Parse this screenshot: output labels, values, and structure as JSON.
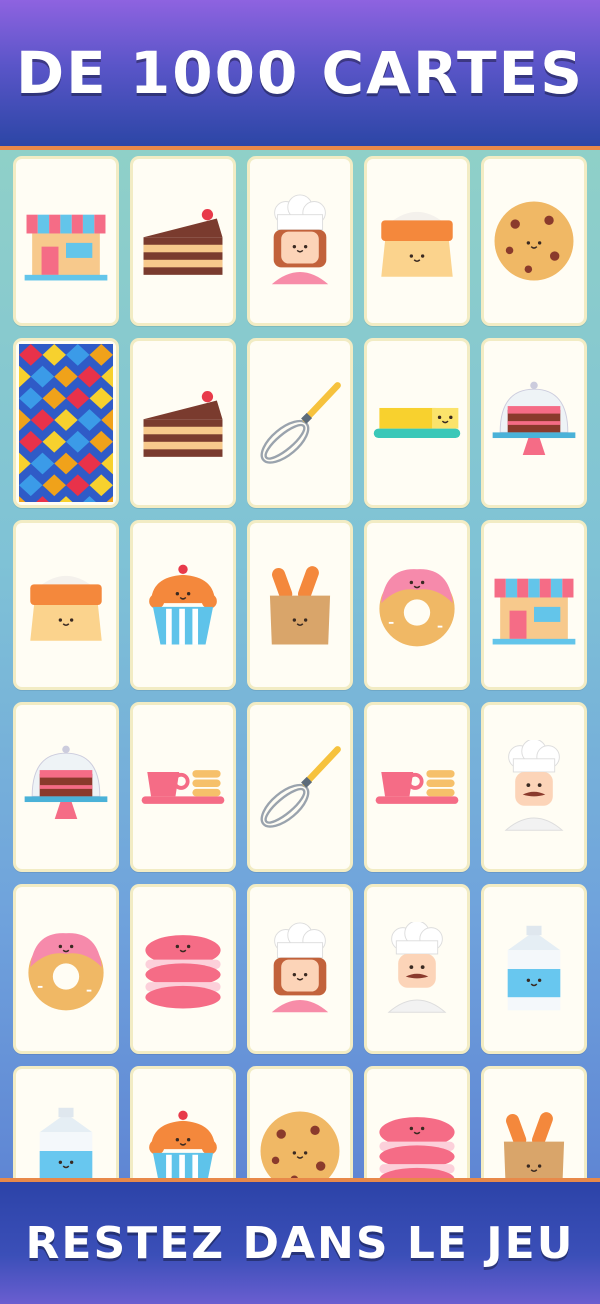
{
  "header": {
    "title": "DE 1000 CARTES"
  },
  "footer": {
    "tagline": "RESTEZ DANS LE JEU"
  },
  "colors": {
    "banner_purple": "#8e63e0",
    "banner_blue": "#2c46a6",
    "accent_orange": "#e8894a",
    "card_face": "#fffdf4"
  },
  "grid": {
    "rows": [
      [
        "shop-icon",
        "cake-slice-icon",
        "girl-chef-icon",
        "flour-sack-icon",
        "cookie-icon"
      ],
      [
        "card-back",
        "cake-slice-icon",
        "whisk-icon",
        "butter-icon",
        "cake-stand-icon"
      ],
      [
        "flour-sack-icon",
        "cupcake-icon",
        "bread-bag-icon",
        "donut-icon",
        "shop-icon"
      ],
      [
        "cake-stand-icon",
        "tea-set-icon",
        "whisk-icon",
        "tea-set-icon",
        "male-chef-icon"
      ],
      [
        "donut-icon",
        "macaron-icon",
        "girl-chef-icon",
        "male-chef-icon",
        "milk-carton-icon"
      ],
      [
        "milk-carton-icon",
        "cupcake-icon",
        "cookie-icon",
        "macaron-icon",
        "bread-bag-icon"
      ]
    ]
  }
}
